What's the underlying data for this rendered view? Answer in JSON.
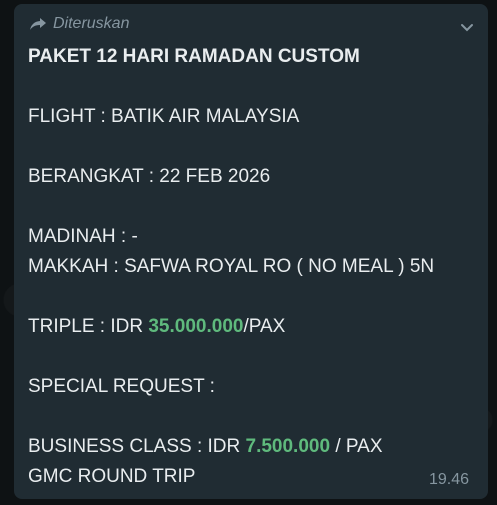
{
  "message": {
    "forwarded_label": "Diteruskan",
    "title": "PAKET 12 HARI RAMADAN CUSTOM",
    "flight": "FLIGHT : BATIK AIR MALAYSIA",
    "departure": "BERANGKAT : 22 FEB 2026",
    "madinah": "MADINAH : -",
    "makkah": "MAKKAH : SAFWA ROYAL RO ( NO MEAL ) 5N",
    "triple_prefix": "TRIPLE : IDR ",
    "triple_price": "35.000.000",
    "triple_suffix": "/PAX",
    "special_request": "SPECIAL REQUEST :",
    "business_prefix": "BUSINESS CLASS : IDR ",
    "business_price": "7.500.000",
    "business_suffix": " / PAX",
    "gmc": "GMC ROUND TRIP",
    "time": "19.46"
  },
  "colors": {
    "bubble": "#202c33",
    "text": "#e9edef",
    "muted": "#8696a0",
    "price": "#5fba7d"
  },
  "icons": {
    "forward": "forward-arrow-icon",
    "menu": "chevron-down-icon"
  }
}
